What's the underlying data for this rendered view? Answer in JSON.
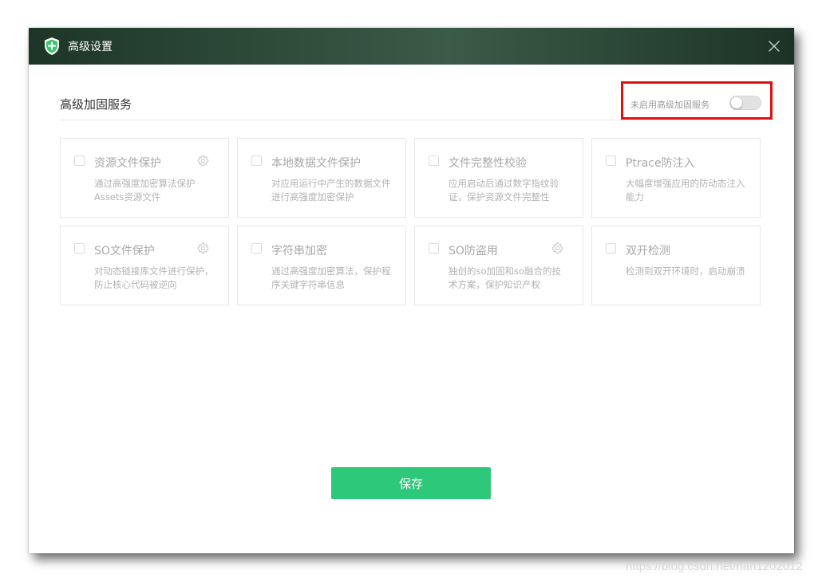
{
  "window": {
    "title": "高级设置"
  },
  "section": {
    "title": "高级加固服务",
    "toggle_label": "未启用高级加固服务",
    "toggle_state": "off"
  },
  "cards": [
    {
      "title": "资源文件保护",
      "desc": "通过高强度加密算法保护Assets资源文件",
      "checked": false,
      "has_settings": true
    },
    {
      "title": "本地数据文件保护",
      "desc": "对应用运行中产生的数据文件进行高强度加密保护",
      "checked": false,
      "has_settings": false
    },
    {
      "title": "文件完整性校验",
      "desc": "应用启动后通过数字指纹验证，保护资源文件完整性",
      "checked": false,
      "has_settings": false
    },
    {
      "title": "Ptrace防注入",
      "desc": "大幅度增强应用的防动态注入能力",
      "checked": false,
      "has_settings": false
    },
    {
      "title": "SO文件保护",
      "desc": "对动态链接库文件进行保护，防止核心代码被逆向",
      "checked": false,
      "has_settings": true
    },
    {
      "title": "字符串加密",
      "desc": "通过高强度加密算法，保护程序关键字符串信息",
      "checked": false,
      "has_settings": false
    },
    {
      "title": "SO防盗用",
      "desc": "独创的so加固和so融合的技术方案，保护知识产权",
      "checked": false,
      "has_settings": true
    },
    {
      "title": "双开检测",
      "desc": "检测到双开环境时，启动崩溃",
      "checked": false,
      "has_settings": false
    }
  ],
  "footer": {
    "save_label": "保存"
  },
  "watermark": "https://blog.csdn.net/han1202012",
  "colors": {
    "accent": "#2ec87a",
    "highlight": "#e01010",
    "titlebar": "#2d4a39"
  },
  "icons": {
    "title": "shield-icon",
    "close": "close-icon",
    "card_settings": "gear-icon"
  }
}
